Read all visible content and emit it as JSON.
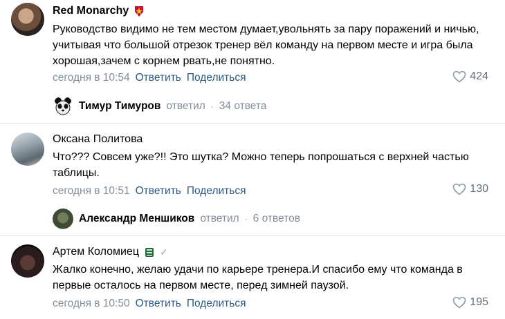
{
  "comments": [
    {
      "author": "Red Monarchy",
      "text": "Руководство видимо не тем местом думает,увольнять за пару поражений и ничью, учитывая что большой отрезок тренер вёл команду на первом месте и игра была хорошая,зачем с корнем рвать,не понятно.",
      "date": "сегодня в 10:54",
      "reply_label": "Ответить",
      "share_label": "Поделиться",
      "likes": "424",
      "replies": {
        "author": "Тимур Тимуров",
        "verb": "ответил",
        "count": "34 ответа"
      }
    },
    {
      "author": "Оксана Политова",
      "text": "Что??? Совсем уже?!! Это шутка? Можно теперь попрошаться с верхней частью таблицы.",
      "date": "сегодня в 10:51",
      "reply_label": "Ответить",
      "share_label": "Поделиться",
      "likes": "130",
      "replies": {
        "author": "Александр Меншиков",
        "verb": "ответил",
        "count": "6 ответов"
      }
    },
    {
      "author": "Артем Коломиец",
      "text": "Жалко конечно, желаю удачи по карьере тренера.И спасибо ему что команда в первые осталось на первом месте, перед зимней паузой.",
      "date": "сегодня в 10:50",
      "reply_label": "Ответить",
      "share_label": "Поделиться",
      "likes": "195"
    }
  ],
  "colors": {
    "link": "#2a5885",
    "meta": "#818c99",
    "likes": "#626d7a"
  },
  "icons": {
    "like": "heart-outline-icon",
    "badge_red": "army-emblem-icon",
    "badge_green": "green-emblem-icon",
    "verified": "checkmark-icon"
  }
}
